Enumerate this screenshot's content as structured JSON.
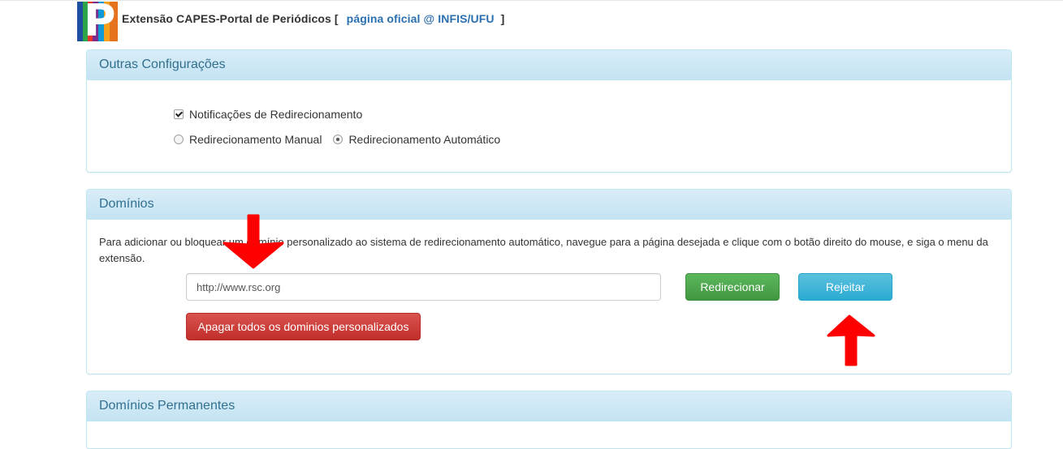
{
  "header": {
    "title": "Extensão CAPES-Portal de Periódicos [",
    "link_text": "página oficial @ INFIS/UFU",
    "closing_bracket": "]"
  },
  "other_settings": {
    "heading": "Outras Configurações",
    "notifications_label": "Notificações de Redirecionamento",
    "notifications_checked": true,
    "manual_label": "Redirecionamento Manual",
    "auto_label": "Redirecionamento Automático",
    "selected_mode": "auto"
  },
  "domains": {
    "heading": "Domínios",
    "description": "Para adicionar ou bloquear um domínio personalizado ao sistema de redirecionamento automático, navegue para a página desejada e clique com o botão direito do mouse, e siga o menu da extensão.",
    "url_value": "http://www.rsc.org",
    "redirect_button": "Redirecionar",
    "reject_button": "Rejeitar",
    "clear_button": "Apagar todos os dominios personalizados"
  },
  "permanent_domains": {
    "heading": "Domínios Permanentes"
  },
  "colors": {
    "annotation_arrow": "#ff0000",
    "success": "#449d44",
    "info": "#31b0d5",
    "danger": "#c9302c"
  },
  "icons": {
    "logo": "portal-periodicos-logo",
    "arrows": [
      "down-arrow-annotation",
      "up-arrow-annotation"
    ]
  }
}
